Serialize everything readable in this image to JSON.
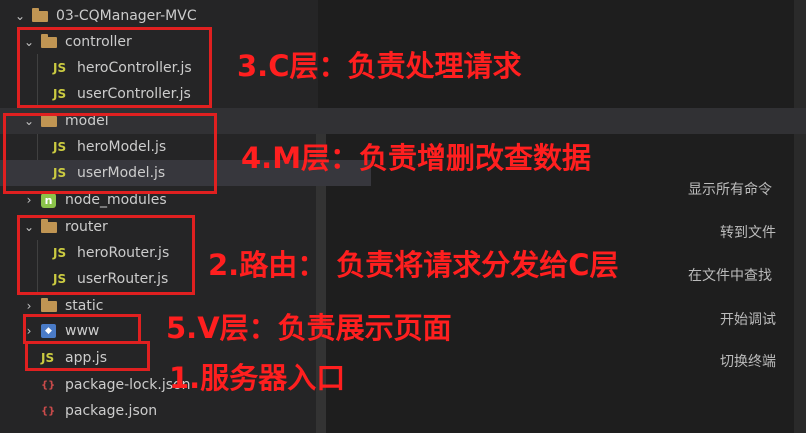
{
  "explorer": {
    "root": "03-CQManager-MVC",
    "folders": {
      "controller": "controller",
      "model": "model",
      "node_modules": "node_modules",
      "router": "router",
      "static": "static",
      "www": "www"
    },
    "files": {
      "heroController": "heroController.js",
      "userController": "userController.js",
      "heroModel": "heroModel.js",
      "userModel": "userModel.js",
      "heroRouter": "heroRouter.js",
      "userRouter": "userRouter.js",
      "app": "app.js",
      "packageLock": "package-lock.json",
      "package": "package.json"
    },
    "js_badge": "JS"
  },
  "annotations": {
    "controller": "3.C层：负责处理请求",
    "model": "4.M层：负责增删改查数据",
    "router": "2.路由：  负责将请求分发给C层",
    "view": "5.V层：负责展示页面",
    "app": "1.服务器入口"
  },
  "commands": [
    "显示所有命令",
    "转到文件",
    "在文件中查找",
    "开始调试",
    "切换终端"
  ],
  "colors": {
    "annotation": "#ff1f1f",
    "folder": "#c09553",
    "js": "#cbcb41"
  }
}
